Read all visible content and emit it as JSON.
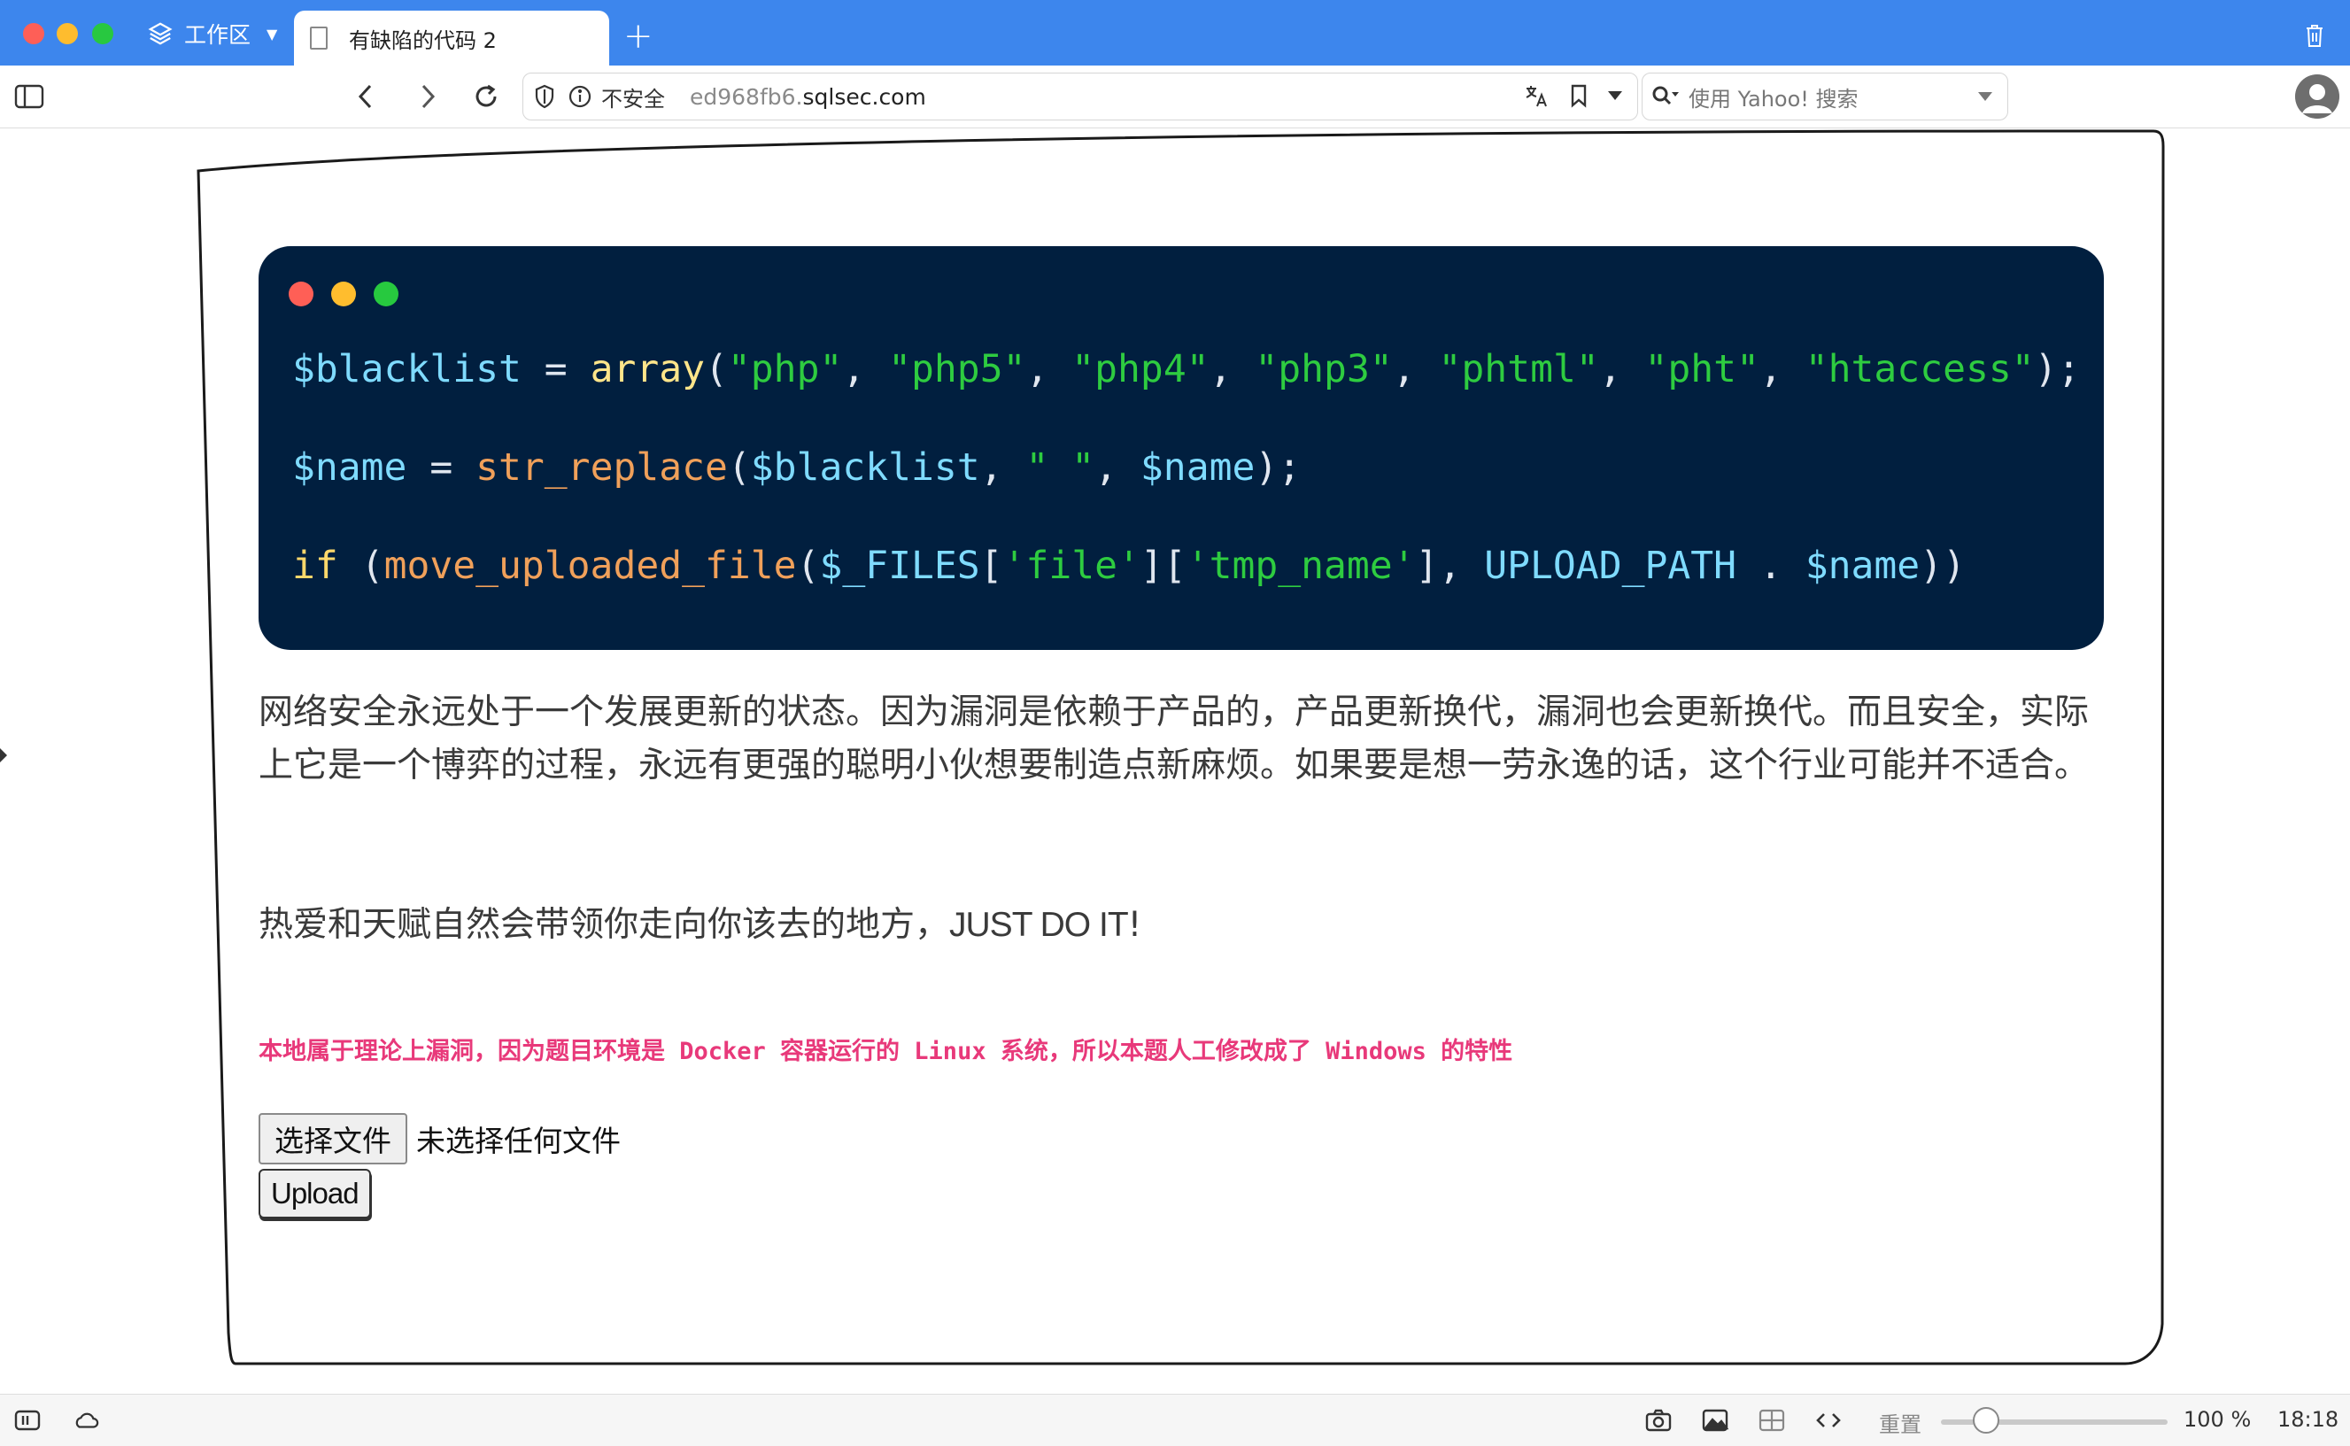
{
  "browser": {
    "workspace_label": "工作区",
    "tab_title": "有缺陷的代码 2",
    "new_tab_symbol": "+",
    "insecure_label": "不安全",
    "url_subdomain": "ed968fb6.",
    "url_domain": "sqlsec.com",
    "search_placeholder": "使用 Yahoo! 搜索"
  },
  "code": {
    "line1": {
      "var": "$blacklist",
      "eq": " = ",
      "fn": "array",
      "open": "(",
      "s1": "\"php\"",
      "s2": "\"php5\"",
      "s3": "\"php4\"",
      "s4": "\"php3\"",
      "s5": "\"phtml\"",
      "s6": "\"pht\"",
      "s7": "\"htaccess\"",
      "sep": ", ",
      "close": ");"
    },
    "line2": {
      "var": "$name",
      "eq": " = ",
      "fn": "str_replace",
      "open": "(",
      "arg1": "$blacklist",
      "sep": ", ",
      "str": "\" \"",
      "arg3": "$name",
      "close": ");"
    },
    "line3": {
      "kw": "if",
      "paren": " (",
      "fn": "move_uploaded_file",
      "open": "(",
      "files": "$_FILES",
      "b1": "[",
      "k1": "'file'",
      "b2": "][",
      "k2": "'tmp_name'",
      "b3": "], ",
      "const": "UPLOAD_PATH",
      "dot": " . ",
      "var": "$name",
      "close": "))"
    }
  },
  "content": {
    "paragraph1": "网络安全永远处于一个发展更新的状态。因为漏洞是依赖于产品的，产品更新换代，漏洞也会更新换代。而且安全，实际上它是一个博弈的过程，永远有更强的聪明小伙想要制造点新麻烦。如果要是想一劳永逸的话，这个行业可能并不适合。",
    "paragraph2_text": "热爱和天赋自然会带领你走向你该去的地方，",
    "paragraph2_em": "JUST DO IT",
    "paragraph2_end": "!",
    "notice": "本地属于理论上漏洞，因为题目环境是 Docker 容器运行的 Linux 系统，所以本题人工修改成了 Windows 的特性",
    "file_button": "选择文件",
    "file_status": "未选择任何文件",
    "upload_button": "Upload"
  },
  "statusbar": {
    "reset_label": "重置",
    "zoom": "100 %",
    "zoom_level": 0.16,
    "time": "18:18"
  }
}
